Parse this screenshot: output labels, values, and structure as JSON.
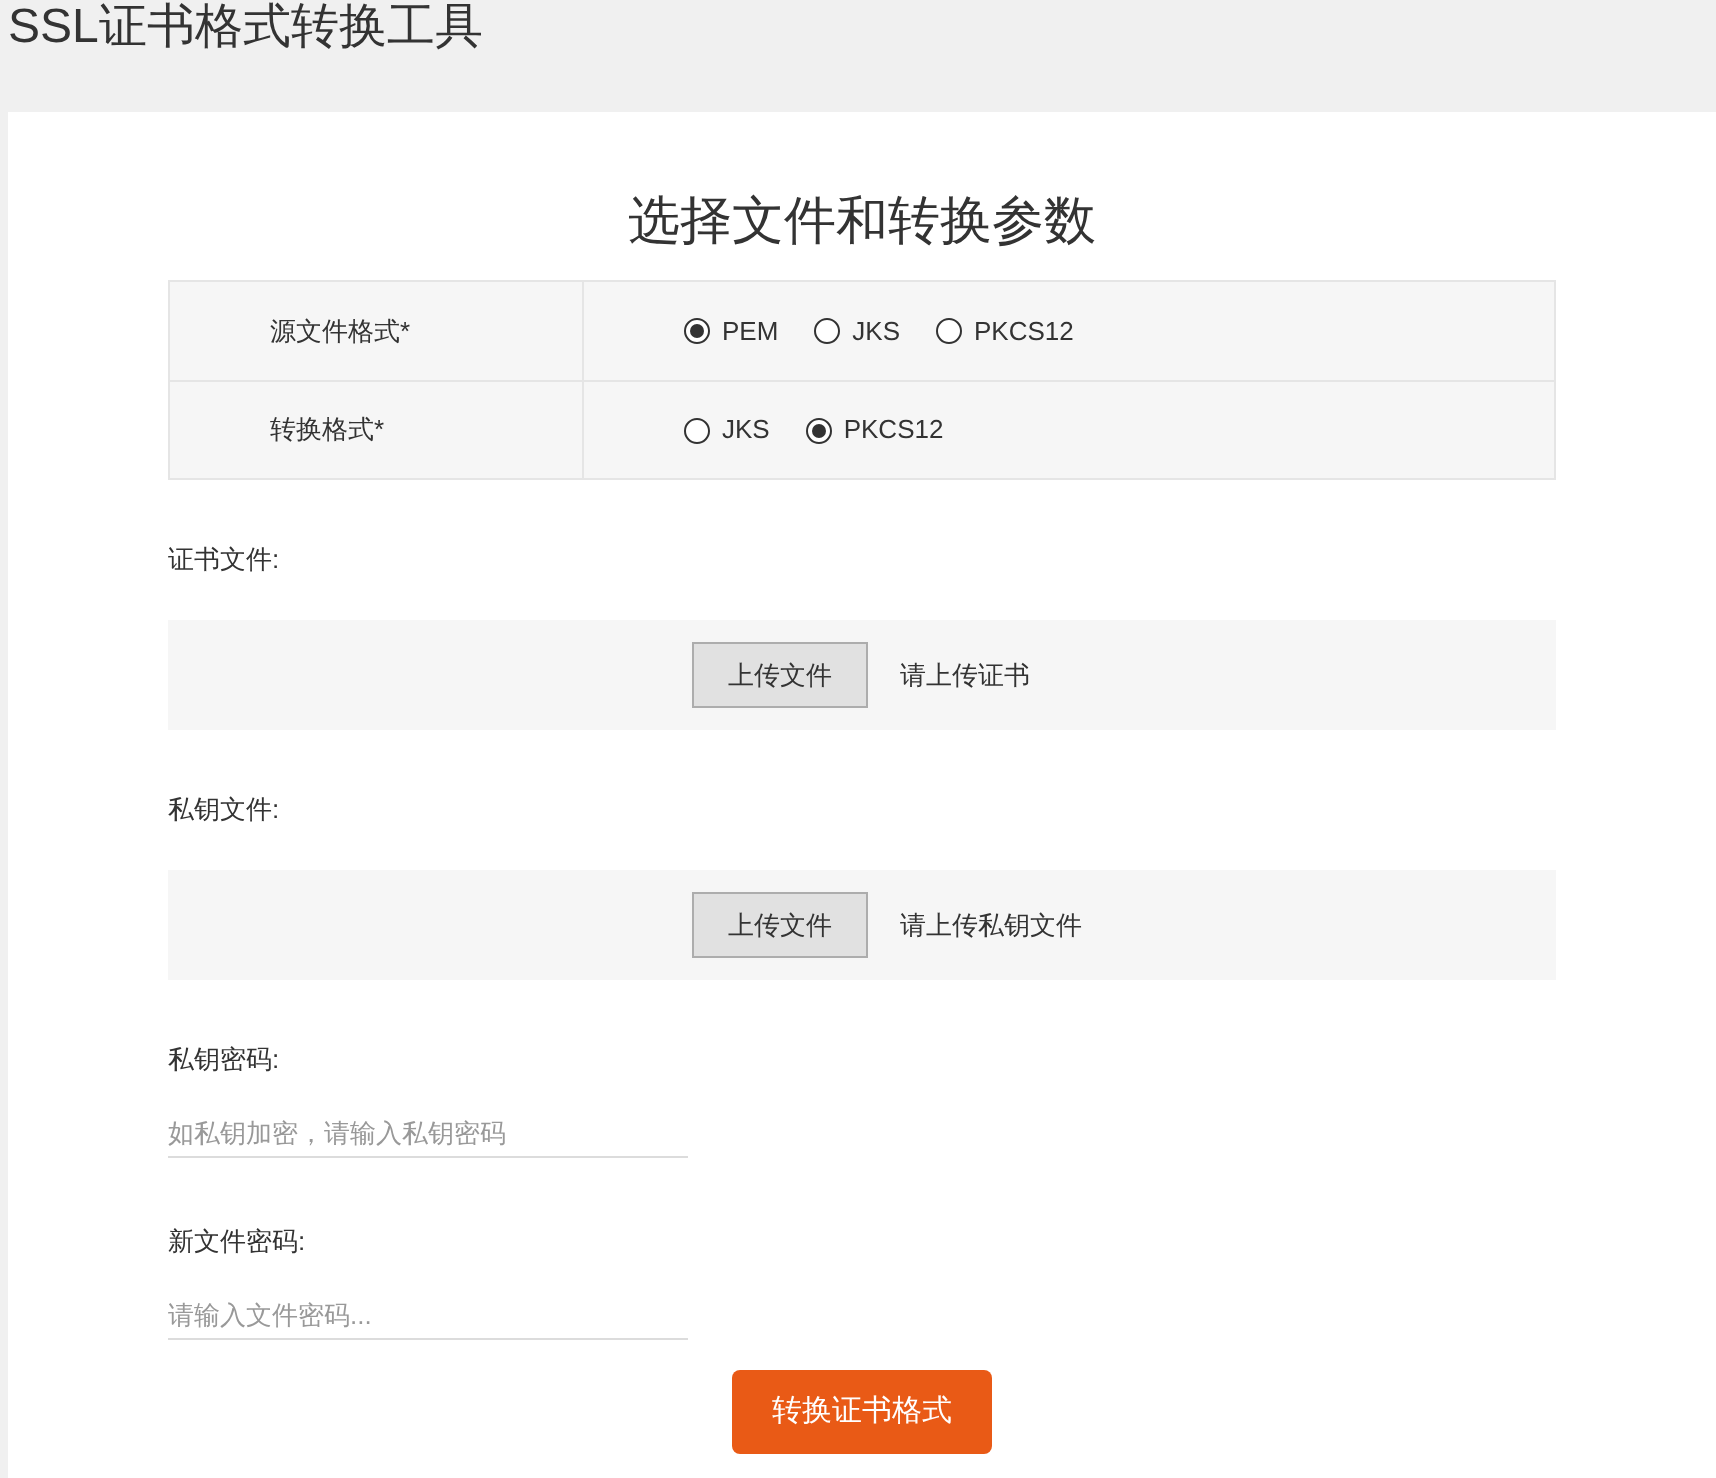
{
  "page_title": "SSL证书格式转换工具",
  "heading": "选择文件和转换参数",
  "options": [
    {
      "label": "源文件格式*",
      "choices": [
        {
          "label": "PEM",
          "selected": true
        },
        {
          "label": "JKS",
          "selected": false
        },
        {
          "label": "PKCS12",
          "selected": false
        }
      ]
    },
    {
      "label": "转换格式*",
      "choices": [
        {
          "label": "JKS",
          "selected": false
        },
        {
          "label": "PKCS12",
          "selected": true
        }
      ]
    }
  ],
  "uploads": [
    {
      "label": "证书文件:",
      "button": "上传文件",
      "hint": "请上传证书"
    },
    {
      "label": "私钥文件:",
      "button": "上传文件",
      "hint": "请上传私钥文件"
    }
  ],
  "passwords": [
    {
      "label": "私钥密码:",
      "placeholder": "如私钥加密，请输入私钥密码"
    },
    {
      "label": "新文件密码:",
      "placeholder": "请输入文件密码..."
    }
  ],
  "submit": "转换证书格式"
}
